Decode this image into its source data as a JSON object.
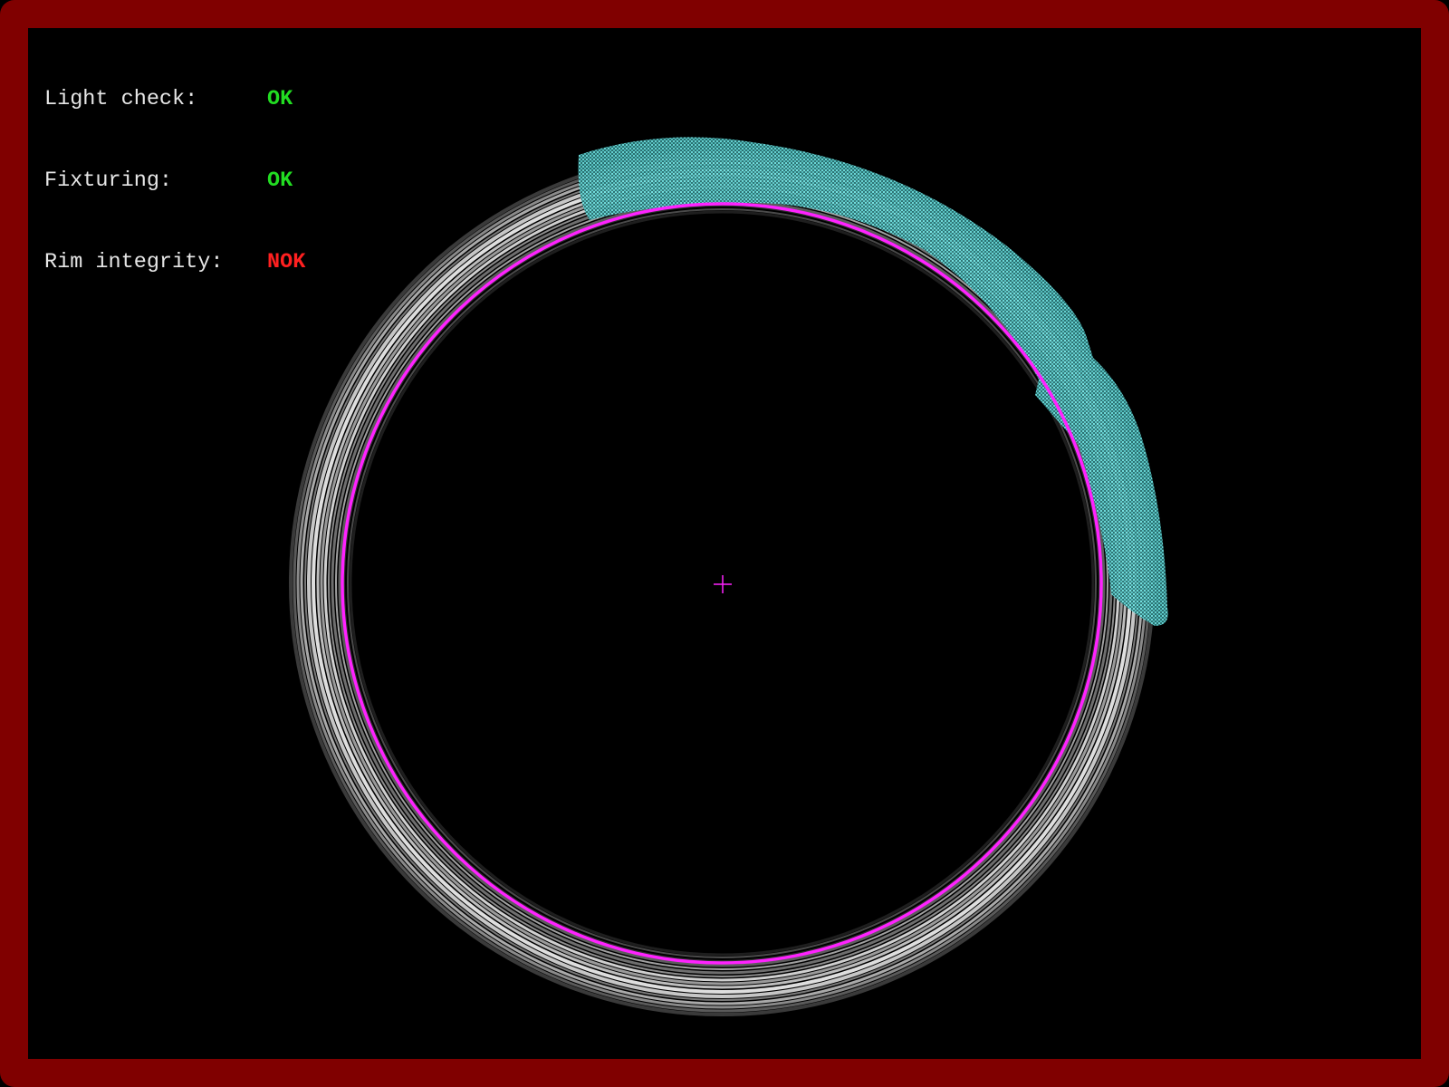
{
  "colors": {
    "frame": "#800000",
    "background": "#000000",
    "ok": "#22dd22",
    "nok": "#ff2020",
    "label_text": "#e6e6e6",
    "detected_edge": "#ff22ff",
    "defect_overlay": "#4fc9c9",
    "rim": "#cfcfcf"
  },
  "status": [
    {
      "label": "Light check:",
      "value": "OK",
      "state": "ok"
    },
    {
      "label": "Fixturing:",
      "value": "OK",
      "state": "ok"
    },
    {
      "label": "Rim integrity:",
      "value": "NOK",
      "state": "nok"
    }
  ],
  "overlays": {
    "center_marker_icon": "crosshair-icon",
    "edge_circle": "detected-inner-edge",
    "defect_region": "rim-defect-region"
  }
}
